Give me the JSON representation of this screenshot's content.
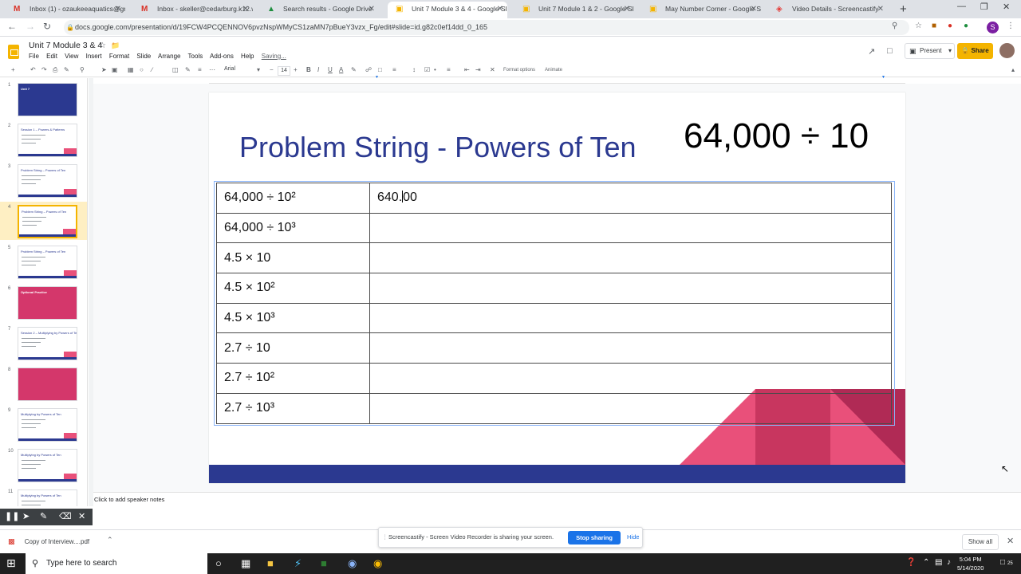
{
  "browser": {
    "tabs": [
      {
        "title": "Inbox (1) - ozaukeeaquatics@gm",
        "icon": "gmail-icon"
      },
      {
        "title": "Inbox - skeller@cedarburg.k12.w",
        "icon": "gmail-icon"
      },
      {
        "title": "Search results - Google Drive",
        "icon": "drive-icon"
      },
      {
        "title": "Unit 7 Module 3 & 4 - Google Sli",
        "icon": "slides-icon",
        "active": true
      },
      {
        "title": "Unit 7 Module 1 & 2 - Google Sli",
        "icon": "slides-icon"
      },
      {
        "title": "May Number Corner - Google Sl",
        "icon": "slides-icon"
      },
      {
        "title": "Video Details - Screencastify",
        "icon": "screencastify-icon"
      }
    ],
    "url": "docs.google.com/presentation/d/19FCW4PCQENNOV6pvzNspWMyCS1zaMN7pBueY3vzx_Fg/edit#slide=id.g82c0ef14dd_0_165",
    "profile_initial": "S"
  },
  "docs": {
    "title": "Unit 7 Module 3 & 4",
    "menu": [
      "File",
      "Edit",
      "View",
      "Insert",
      "Format",
      "Slide",
      "Arrange",
      "Tools",
      "Add-ons",
      "Help"
    ],
    "status": "Saving...",
    "present_label": "Present",
    "share_label": "Share",
    "font": "Arial",
    "font_size": "14",
    "format_options": "Format options",
    "animate": "Animate"
  },
  "filmstrip": [
    {
      "num": "1",
      "title": "Unit 7",
      "style": "blue"
    },
    {
      "num": "2",
      "title": "Session 1 – Powers & Patterns",
      "style": "white"
    },
    {
      "num": "3",
      "title": "Problem String – Powers of Ten",
      "style": "white"
    },
    {
      "num": "4",
      "title": "Problem String – Powers of Ten",
      "style": "white",
      "selected": true
    },
    {
      "num": "5",
      "title": "Problem String – Powers of Ten",
      "style": "white"
    },
    {
      "num": "6",
      "title": "Optional Practice",
      "style": "pink"
    },
    {
      "num": "7",
      "title": "Session 2 – Multiplying by Powers of Ten",
      "style": "white"
    },
    {
      "num": "8",
      "title": "",
      "style": "pink"
    },
    {
      "num": "9",
      "title": "Multiplying by Powers of Ten",
      "style": "white"
    },
    {
      "num": "10",
      "title": "Multiplying by Powers of Ten",
      "style": "white"
    },
    {
      "num": "11",
      "title": "Multiplying by Powers of Ten",
      "style": "white"
    }
  ],
  "slide": {
    "title": "Problem String - Powers of Ten",
    "expression": "64,000 ÷ 10",
    "rows": [
      {
        "problem": "64,000 ÷ 10²",
        "answer_before": "640.",
        "answer_after": "00"
      },
      {
        "problem": "64,000 ÷ 10³",
        "answer_before": "",
        "answer_after": ""
      },
      {
        "problem": "4.5 × 10",
        "answer_before": "",
        "answer_after": ""
      },
      {
        "problem": "4.5 × 10²",
        "answer_before": "",
        "answer_after": ""
      },
      {
        "problem": "4.5 × 10³",
        "answer_before": "",
        "answer_after": ""
      },
      {
        "problem": "2.7 ÷ 10",
        "answer_before": "",
        "answer_after": ""
      },
      {
        "problem": "2.7 ÷ 10²",
        "answer_before": "",
        "answer_after": ""
      },
      {
        "problem": "2.7 ÷ 10³",
        "answer_before": "",
        "answer_after": ""
      }
    ],
    "colors": {
      "title": "#2b3990",
      "footer": "#2b3990",
      "accent_pink": "#e9507a",
      "dark_pink": "#c8365f"
    }
  },
  "notes_placeholder": "Click to add speaker notes",
  "screencastify": {
    "banner_text": "Screencastify - Screen Video Recorder is sharing your screen.",
    "stop_label": "Stop sharing",
    "hide_label": "Hide"
  },
  "downloads": {
    "file": "Copy of Interview....pdf",
    "show_all": "Show all"
  },
  "taskbar": {
    "search_placeholder": "Type here to search",
    "time": "5:04 PM",
    "date": "5/14/2020",
    "notification_count": "25"
  }
}
